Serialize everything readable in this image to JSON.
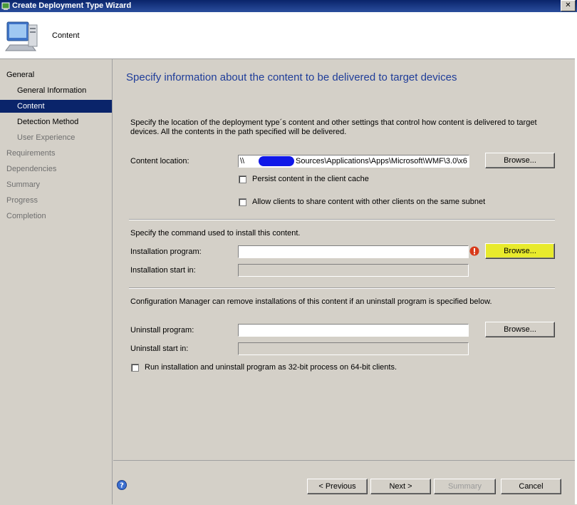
{
  "window": {
    "title": "Create Deployment Type Wizard",
    "close_glyph": "✕"
  },
  "header": {
    "title": "Content",
    "icon": "computer-icon"
  },
  "nav": {
    "items": [
      {
        "label": "General",
        "state": "normal"
      },
      {
        "label": "General Information",
        "state": "normal"
      },
      {
        "label": "Content",
        "state": "active"
      },
      {
        "label": "Detection Method",
        "state": "normal"
      },
      {
        "label": "User Experience",
        "state": "dim"
      },
      {
        "label": "Requirements",
        "state": "dim"
      },
      {
        "label": "Dependencies",
        "state": "dim"
      },
      {
        "label": "Summary",
        "state": "dim"
      },
      {
        "label": "Progress",
        "state": "dim"
      },
      {
        "label": "Completion",
        "state": "dim"
      }
    ]
  },
  "page": {
    "title": "Specify information about the content to be delivered to target devices",
    "description": "Specify the location of the deployment type´s content and other settings that control how content is delivered to target devices. All the contents in the path specified will be delivered.",
    "content_location": {
      "label": "Content location:",
      "value_prefix": "\\\\",
      "value": "Sources\\Applications\\Apps\\Microsoft\\WMF\\3.0\\x6",
      "browse": "Browse..."
    },
    "persist_content": {
      "label": "Persist content in the client cache",
      "checked": false
    },
    "allow_share": {
      "label": "Allow clients to share content with other clients on the same subnet",
      "checked": false
    },
    "install_section": "Specify the command used to install this content.",
    "installation_program": {
      "label": "Installation program:",
      "value": "",
      "browse": "Browse..."
    },
    "installation_start_in": {
      "label": "Installation start in:",
      "value": ""
    },
    "uninstall_section": "Configuration Manager can remove installations of this content if an uninstall program is specified below.",
    "uninstall_program": {
      "label": "Uninstall program:",
      "value": "",
      "browse": "Browse..."
    },
    "uninstall_start_in": {
      "label": "Uninstall start in:",
      "value": ""
    },
    "run_32bit": {
      "label": "Run installation and uninstall program as 32-bit process on 64-bit clients.",
      "checked": false
    }
  },
  "footer": {
    "previous": "< Previous",
    "next": "Next >",
    "summary": "Summary",
    "cancel": "Cancel"
  },
  "colors": {
    "accent": "#0a246a",
    "title_text": "#1f3d99",
    "highlight": "#e8ea2c",
    "error": "#d83a1a"
  }
}
